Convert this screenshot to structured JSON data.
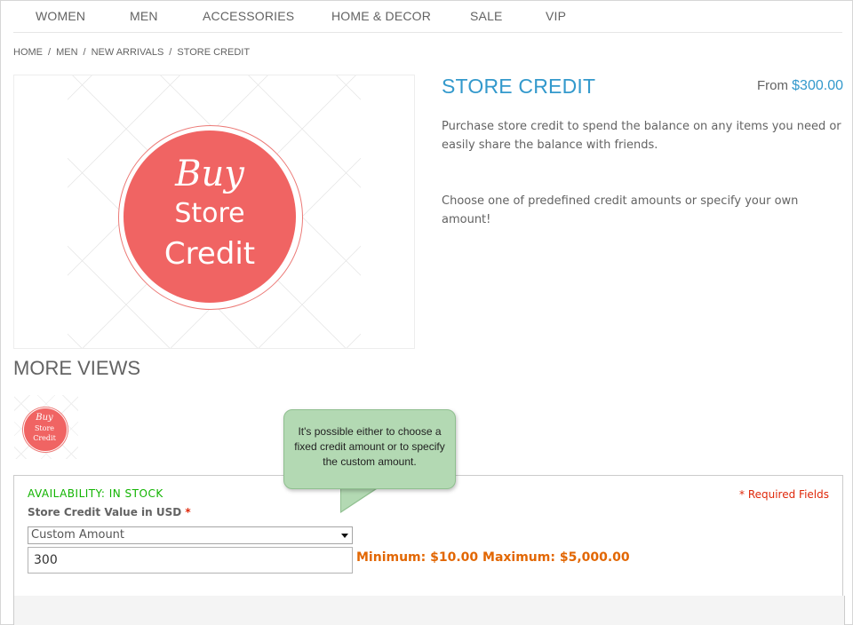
{
  "nav": {
    "items": [
      "WOMEN",
      "MEN",
      "ACCESSORIES",
      "HOME & DECOR",
      "SALE",
      "VIP"
    ]
  },
  "breadcrumb": {
    "items": [
      "HOME",
      "MEN",
      "NEW ARRIVALS",
      "STORE CREDIT"
    ],
    "separator": "/"
  },
  "product": {
    "image_text": {
      "line1": "Buy",
      "line2": "Store",
      "line3": "Credit"
    },
    "title": "STORE CREDIT",
    "price_prefix": "From",
    "price": "$300.00",
    "description_1": "Purchase store credit to spend the balance on any items you need or easily share the balance with friends.",
    "description_2": "Choose one of predefined credit amounts or specify your own amount!"
  },
  "more_views": {
    "heading": "MORE VIEWS",
    "thumb_text": {
      "line1": "Buy",
      "line2": "Store",
      "line3": "Credit"
    }
  },
  "options": {
    "availability": "AVAILABILITY: IN STOCK",
    "required_fields": "* Required Fields",
    "field_label": "Store Credit Value in USD",
    "required_star": "*",
    "select_value": "Custom Amount",
    "amount_value": "300",
    "minmax": "Minimum: $10.00 Maximum: $5,000.00"
  },
  "tooltip": {
    "text": "It's possible either to choose a fixed credit amount or to specify the custom amount."
  },
  "colors": {
    "accent": "#3399cc",
    "in_stock": "#11b400",
    "required": "#df280a",
    "minmax": "#e26703",
    "badge": "#f06463",
    "tooltip": "#b3d9b3"
  }
}
